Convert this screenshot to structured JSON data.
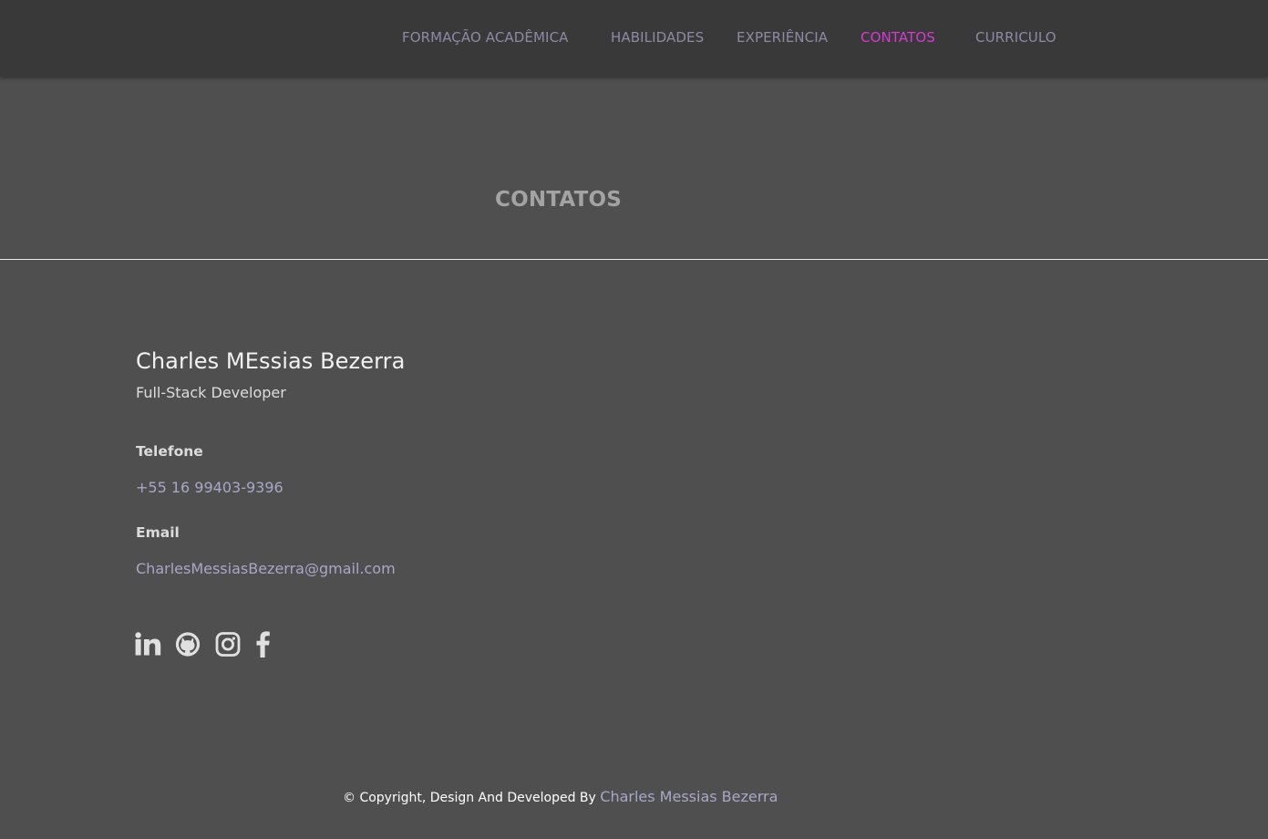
{
  "nav": {
    "items": [
      {
        "label": "FORMAÇÃO ACADÊMICA",
        "active": false
      },
      {
        "label": "HABILIDADES",
        "active": false
      },
      {
        "label": "EXPERIÊNCIA",
        "active": false
      },
      {
        "label": "CONTATOS",
        "active": true
      },
      {
        "label": "CURRICULO",
        "active": false
      }
    ],
    "active_color": "#d63bd6",
    "text_color": "#8d8aa6"
  },
  "section": {
    "title": "CONTATOS"
  },
  "contact": {
    "name": "Charles MEssias Bezerra",
    "role": "Full-Stack Developer",
    "phone_label": "Telefone",
    "phone": "+55 16 99403-9396",
    "email_label": "Email",
    "email": "CharlesMessiasBezerra@gmail.com"
  },
  "social": [
    {
      "icon": "linkedin-icon"
    },
    {
      "icon": "github-icon"
    },
    {
      "icon": "instagram-icon"
    },
    {
      "icon": "facebook-icon"
    }
  ],
  "footer": {
    "text": "© Copyright, Design And Developed By ",
    "author": "Charles Messias Bezerra"
  },
  "colors": {
    "background": "#4f4f4f",
    "navbar": "#393939",
    "link": "#a9a7c7"
  }
}
